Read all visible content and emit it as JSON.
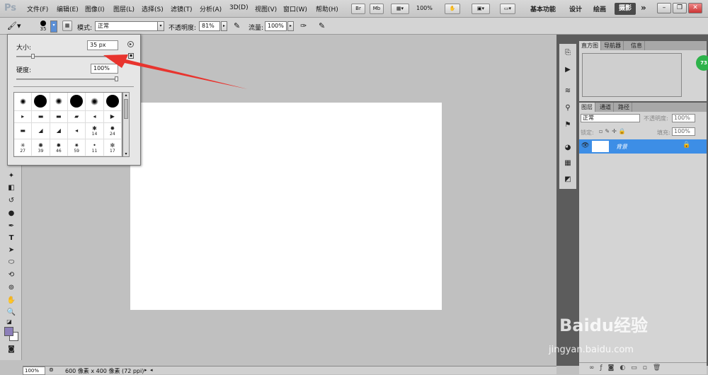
{
  "app": {
    "logo": "Ps"
  },
  "menu": [
    {
      "label": "文件(F)"
    },
    {
      "label": "编辑(E)"
    },
    {
      "label": "图像(I)"
    },
    {
      "label": "图层(L)"
    },
    {
      "label": "选择(S)"
    },
    {
      "label": "滤镜(T)"
    },
    {
      "label": "分析(A)"
    },
    {
      "label": "3D(D)"
    },
    {
      "label": "视图(V)"
    },
    {
      "label": "窗口(W)"
    },
    {
      "label": "帮助(H)"
    }
  ],
  "appbar": {
    "br": "Br",
    "mb": "Mb",
    "zoom": "100%"
  },
  "workspaces": {
    "essentials": "基本功能",
    "design": "设计",
    "painting": "绘画",
    "photography": "摄影",
    "more": "»"
  },
  "options": {
    "brush_size": "35",
    "mode_label": "模式:",
    "mode_value": "正常",
    "opacity_label": "不透明度:",
    "opacity_value": "81%",
    "flow_label": "流量:",
    "flow_value": "100%"
  },
  "brush_panel": {
    "size_label": "大小:",
    "size_value": "35 px",
    "hardness_label": "硬度:",
    "hardness_value": "100%",
    "presets": [
      {
        "label": ""
      },
      {
        "label": ""
      },
      {
        "label": ""
      },
      {
        "label": ""
      },
      {
        "label": ""
      },
      {
        "label": ""
      },
      {
        "label": ""
      },
      {
        "label": ""
      },
      {
        "label": ""
      },
      {
        "label": ""
      },
      {
        "label": ""
      },
      {
        "label": ""
      },
      {
        "label": ""
      },
      {
        "label": ""
      },
      {
        "label": ""
      },
      {
        "label": ""
      },
      {
        "label": "14"
      },
      {
        "label": "24"
      },
      {
        "label": "27"
      },
      {
        "label": "39"
      },
      {
        "label": "46"
      },
      {
        "label": "59"
      },
      {
        "label": "11"
      },
      {
        "label": "17"
      }
    ]
  },
  "panels": {
    "top_tabs": [
      "直方图",
      "导航器",
      "信息"
    ],
    "layer_tabs": [
      "图层",
      "通道",
      "路径"
    ],
    "blend_mode": "正常",
    "opacity_label": "不透明度:",
    "opacity_value": "100%",
    "lock_label": "锁定:",
    "fill_label": "填充:",
    "fill_value": "100%",
    "layer_name": "背景"
  },
  "status": {
    "zoom": "100%",
    "doc_info": "600 像素 x 400 像素 (72 ppi)"
  },
  "badge": {
    "value": "73"
  },
  "watermark": {
    "text": "Baidu经验",
    "url": "jingyan.baidu.com"
  }
}
